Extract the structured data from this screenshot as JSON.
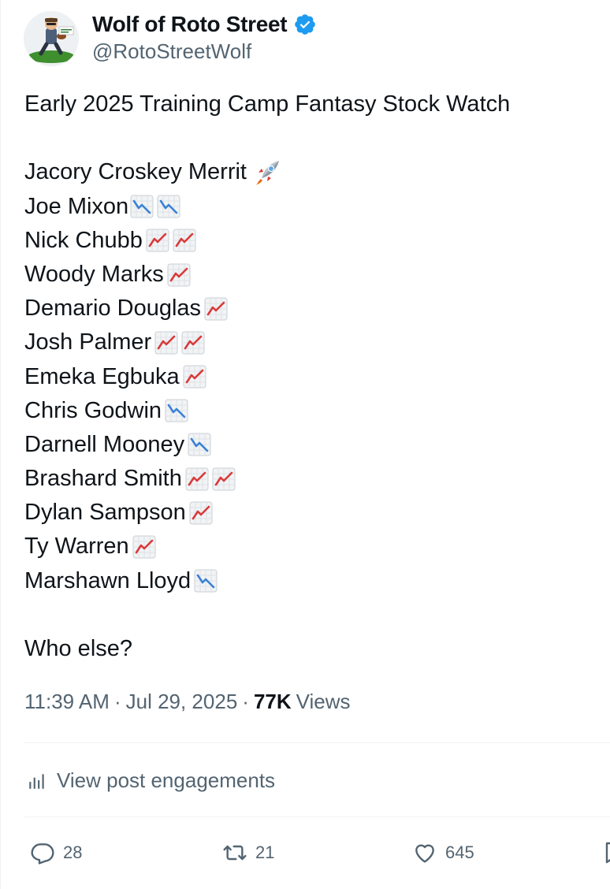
{
  "author": {
    "display_name": "Wolf of Roto Street",
    "handle": "@RotoStreetWolf",
    "verified": true,
    "avatar_icon": "avatar-cartoon-runner"
  },
  "post": {
    "headline": "Early 2025 Training Camp Fantasy Stock Watch",
    "lines": [
      {
        "text": "Jacory Croskey Merrit",
        "emojis": [
          "rocket"
        ]
      },
      {
        "text": "Joe Mixon",
        "emojis": [
          "chart-down",
          "chart-down"
        ]
      },
      {
        "text": "Nick Chubb",
        "emojis": [
          "chart-up",
          "chart-up"
        ]
      },
      {
        "text": "Woody Marks",
        "emojis": [
          "chart-up"
        ]
      },
      {
        "text": "Demario Douglas",
        "emojis": [
          "chart-up"
        ]
      },
      {
        "text": "Josh Palmer",
        "emojis": [
          "chart-up",
          "chart-up"
        ]
      },
      {
        "text": "Emeka Egbuka",
        "emojis": [
          "chart-up"
        ]
      },
      {
        "text": "Chris Godwin",
        "emojis": [
          "chart-down"
        ]
      },
      {
        "text": "Darnell Mooney",
        "emojis": [
          "chart-down"
        ]
      },
      {
        "text": "Brashard Smith",
        "emojis": [
          "chart-up",
          "chart-up"
        ]
      },
      {
        "text": "Dylan Sampson",
        "emojis": [
          "chart-up"
        ]
      },
      {
        "text": "Ty Warren",
        "emojis": [
          "chart-up"
        ]
      },
      {
        "text": "Marshawn Lloyd",
        "emojis": [
          "chart-down"
        ]
      }
    ],
    "closing": "Who else?"
  },
  "meta": {
    "time": "11:39 AM",
    "separator": "·",
    "date": "Jul 29, 2025",
    "views_count": "77K",
    "views_label": "Views"
  },
  "engagements": {
    "label": "View post engagements",
    "icon": "bar-chart-icon"
  },
  "actions": {
    "replies": "28",
    "reposts": "21",
    "likes": "645"
  },
  "colors": {
    "text": "#0f1419",
    "secondary": "#536471",
    "verified": "#1d9bf0",
    "divider": "#eff3f4",
    "chart_up": "#d93a3a",
    "chart_down": "#3b82d6"
  }
}
